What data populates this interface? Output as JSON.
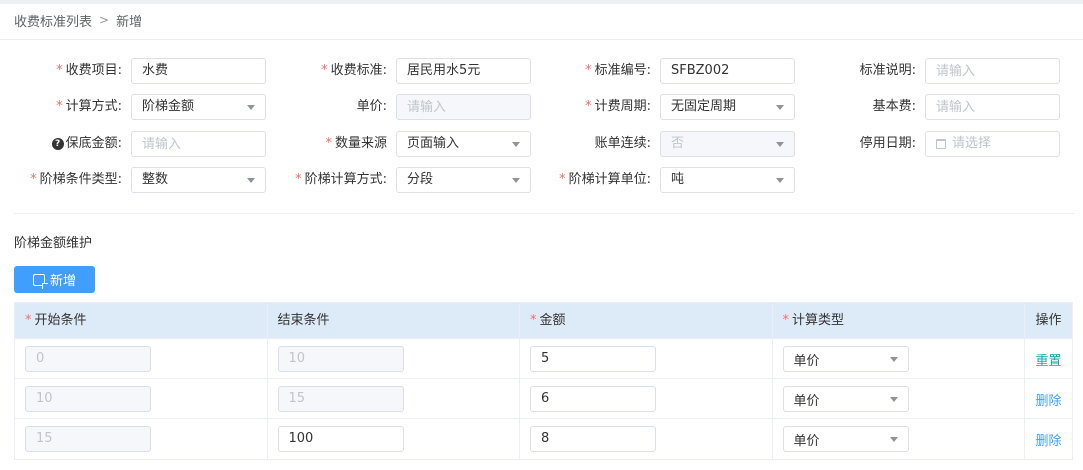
{
  "breadcrumb": {
    "parent": "收费标准列表",
    "current": "新增"
  },
  "form": {
    "row1": {
      "item_label": "收费项目:",
      "item_value": "水费",
      "standard_label": "收费标准:",
      "standard_value": "居民用水5元",
      "code_label": "标准编号:",
      "code_value": "SFBZ002",
      "desc_label": "标准说明:",
      "desc_placeholder": "请输入"
    },
    "row2": {
      "calc_label": "计算方式:",
      "calc_value": "阶梯金额",
      "price_label": "单价:",
      "price_placeholder": "请输入",
      "period_label": "计费周期:",
      "period_value": "无固定周期",
      "base_label": "基本费:",
      "base_placeholder": "请输入"
    },
    "row3": {
      "deposit_label": "保底金额:",
      "deposit_placeholder": "请输入",
      "qty_label": "数量来源",
      "qty_value": "页面输入",
      "bill_label": "账单连续:",
      "bill_value": "否",
      "stop_label": "停用日期:",
      "stop_placeholder": "请选择"
    },
    "row4": {
      "tier_type_label": "阶梯条件类型:",
      "tier_type_value": "整数",
      "tier_calc_label": "阶梯计算方式:",
      "tier_calc_value": "分段",
      "tier_unit_label": "阶梯计算单位:",
      "tier_unit_value": "吨"
    }
  },
  "tier_section": {
    "title": "阶梯金额维护",
    "add_label": "新增",
    "columns": [
      "开始条件",
      "结束条件",
      "金额",
      "计算类型",
      "操作"
    ],
    "rows": [
      {
        "start": "0",
        "end": "10",
        "amount": "5",
        "type": "单价",
        "action": "重置"
      },
      {
        "start": "10",
        "end": "15",
        "amount": "6",
        "type": "单价",
        "action": "删除"
      },
      {
        "start": "15",
        "end": "100",
        "amount": "8",
        "type": "单价",
        "action": "删除"
      }
    ]
  },
  "colors": {
    "primary": "#409eff",
    "required": "#f56c6c",
    "reset_link": "#13a8a8",
    "delete_link": "#409eff",
    "table_header": "#ddebf9"
  }
}
